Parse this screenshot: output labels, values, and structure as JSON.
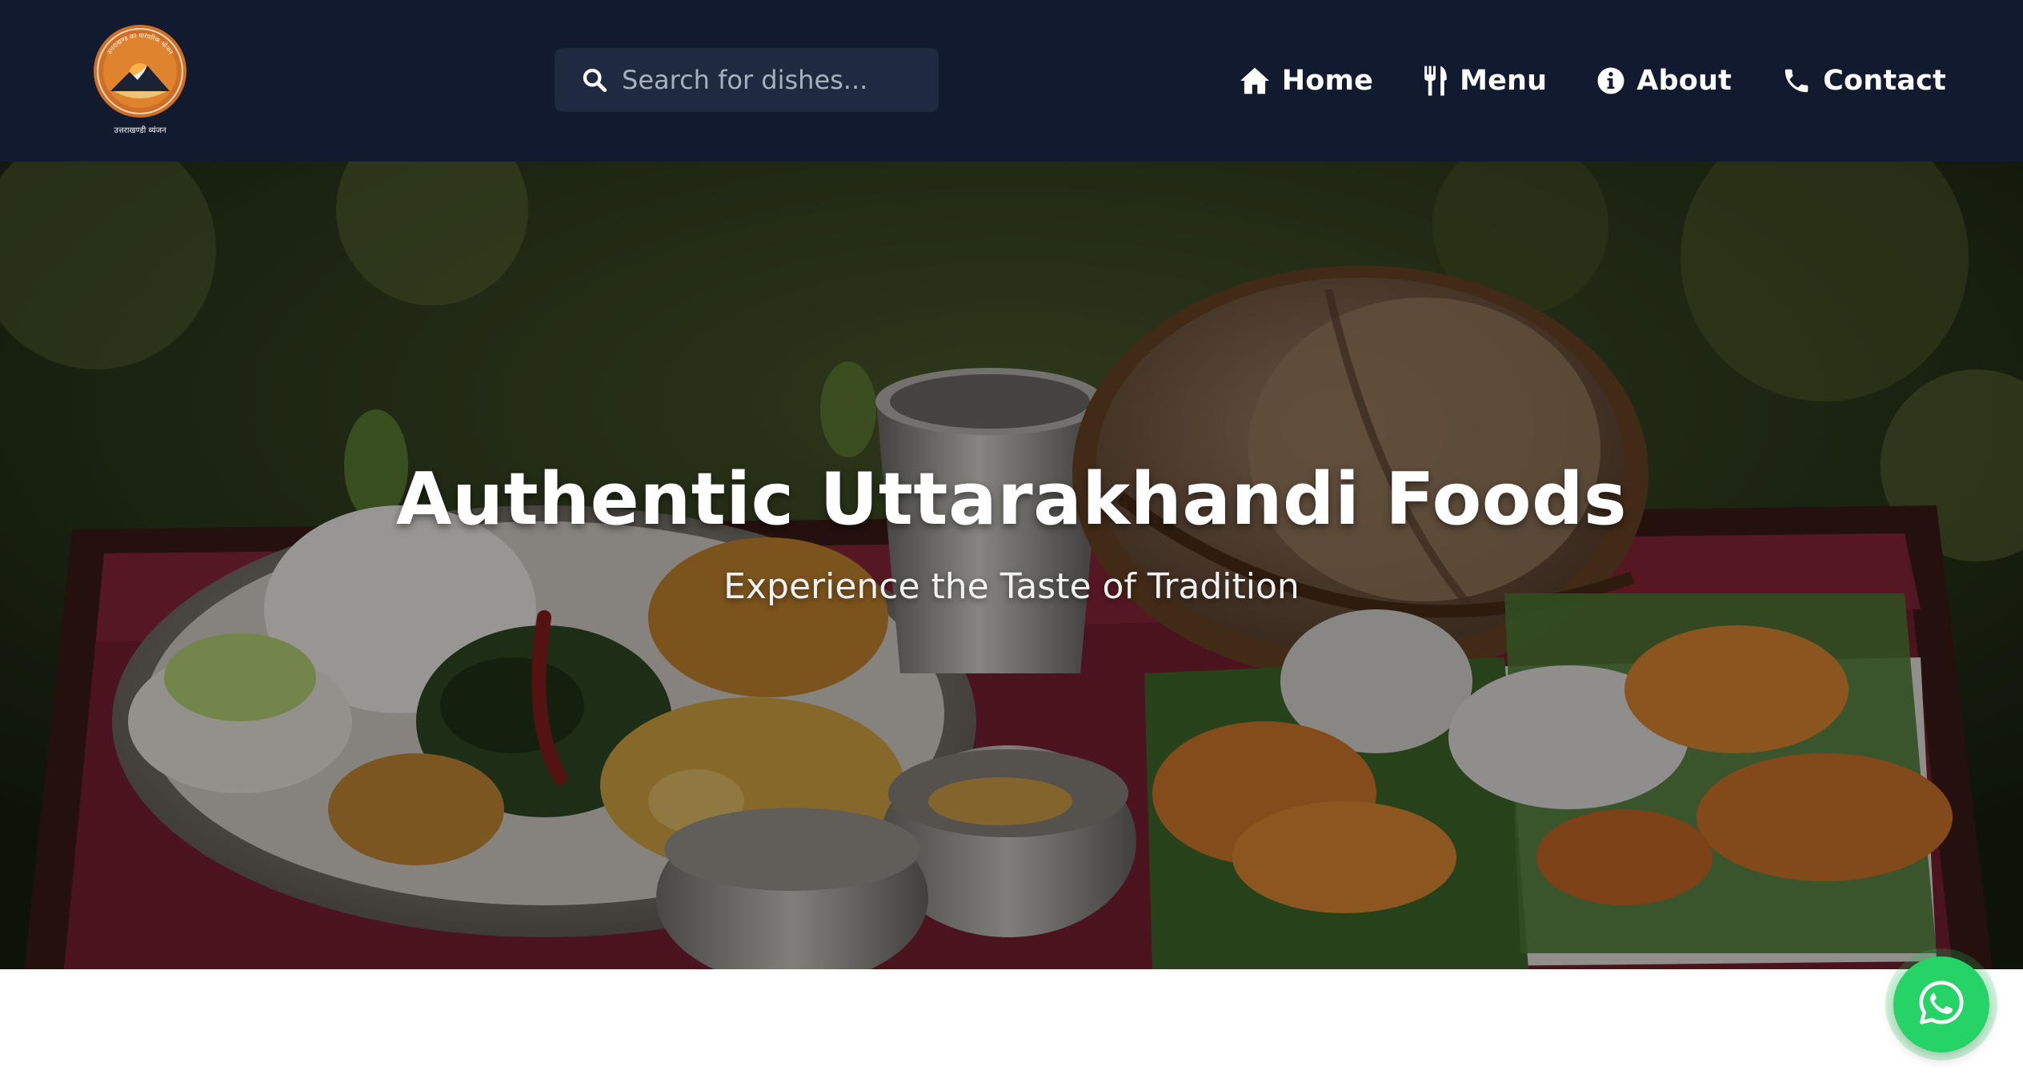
{
  "header": {
    "logo": {
      "icon": "mountain-sunset-logo",
      "arc_text": "उत्तराखण्ड का पारंपरिक भोजन",
      "caption": "उत्तराखण्डी व्यंजन"
    },
    "search": {
      "placeholder": "Search for dishes...",
      "value": "",
      "icon": "search-icon"
    },
    "nav": [
      {
        "label": "Home",
        "icon": "home-icon"
      },
      {
        "label": "Menu",
        "icon": "utensils-icon"
      },
      {
        "label": "About",
        "icon": "info-circle-icon"
      },
      {
        "label": "Contact",
        "icon": "phone-icon"
      }
    ]
  },
  "hero": {
    "title": "Authentic Uttarakhandi Foods",
    "subtitle": "Experience the Taste of Tradition",
    "image": "thali-with-rotis-and-sweets-photo"
  },
  "whatsapp": {
    "icon": "whatsapp-icon"
  },
  "colors": {
    "header_bg": "#111a2f",
    "search_bg": "#1f2a40",
    "nav_text": "#ffffff",
    "logo_orange": "#d9762b",
    "whatsapp_green": "#25d366"
  }
}
